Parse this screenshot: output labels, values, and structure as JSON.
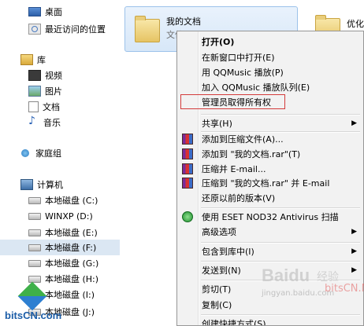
{
  "sidebar": {
    "items": [
      {
        "label": "桌面",
        "icon": "desktop-icon"
      },
      {
        "label": "最近访问的位置",
        "icon": "recent-places-icon"
      },
      {
        "label": "库",
        "icon": "library-icon"
      },
      {
        "label": "视频",
        "icon": "video-icon"
      },
      {
        "label": "图片",
        "icon": "picture-icon"
      },
      {
        "label": "文档",
        "icon": "document-icon"
      },
      {
        "label": "音乐",
        "icon": "music-icon"
      },
      {
        "label": "家庭组",
        "icon": "homegroup-icon"
      },
      {
        "label": "计算机",
        "icon": "computer-icon"
      },
      {
        "label": "本地磁盘 (C:)",
        "icon": "drive-icon"
      },
      {
        "label": "WINXP (D:)",
        "icon": "drive-icon"
      },
      {
        "label": "本地磁盘 (E:)",
        "icon": "drive-icon"
      },
      {
        "label": "本地磁盘 (F:)",
        "icon": "drive-icon",
        "selected": true
      },
      {
        "label": "本地磁盘 (G:)",
        "icon": "drive-icon"
      },
      {
        "label": "本地磁盘 (H:)",
        "icon": "drive-icon"
      },
      {
        "label": "本地磁盘 (I:)",
        "icon": "drive-icon"
      },
      {
        "label": "本地磁盘 (J:)",
        "icon": "drive-icon"
      }
    ]
  },
  "files": {
    "selected_name": "我的文档",
    "selected_sub": "文件",
    "other_name": "优化大"
  },
  "menu": {
    "items": [
      {
        "label": "打开(O)",
        "bold": true
      },
      {
        "label": "在新窗口中打开(E)"
      },
      {
        "label": "用 QQMusic 播放(P)"
      },
      {
        "label": "加入 QQMusic 播放队列(E)"
      },
      {
        "label": "管理员取得所有权"
      },
      {
        "label": "共享(H)",
        "submenu": true
      },
      {
        "label": "添加到压缩文件(A)...",
        "icon": "winrar-icon"
      },
      {
        "label": "添加到 \"我的文档.rar\"(T)",
        "icon": "winrar-icon"
      },
      {
        "label": "压缩并 E-mail...",
        "icon": "winrar-icon"
      },
      {
        "label": "压缩到 \"我的文档.rar\" 并 E-mail",
        "icon": "winrar-icon"
      },
      {
        "label": "还原以前的版本(V)"
      },
      {
        "label": "使用 ESET NOD32 Antivirus 扫描",
        "icon": "eset-icon"
      },
      {
        "label": "高级选项",
        "submenu": true
      },
      {
        "label": "包含到库中(I)",
        "submenu": true
      },
      {
        "label": "发送到(N)",
        "submenu": true
      },
      {
        "label": "剪切(T)"
      },
      {
        "label": "复制(C)"
      },
      {
        "label": "创建快捷方式(S)"
      }
    ],
    "submenu_arrow": "▶"
  },
  "watermarks": {
    "left": "bitsCN.com",
    "baidu": "Baidu",
    "baidu_cn": "经验",
    "url": "jingyan.baidu.com",
    "brand": "bitsCN.Net"
  },
  "colors": {
    "selection": "#dbe7f3",
    "highlight_box": "#d33b3b",
    "menu_bg": "#f2f2f2"
  }
}
